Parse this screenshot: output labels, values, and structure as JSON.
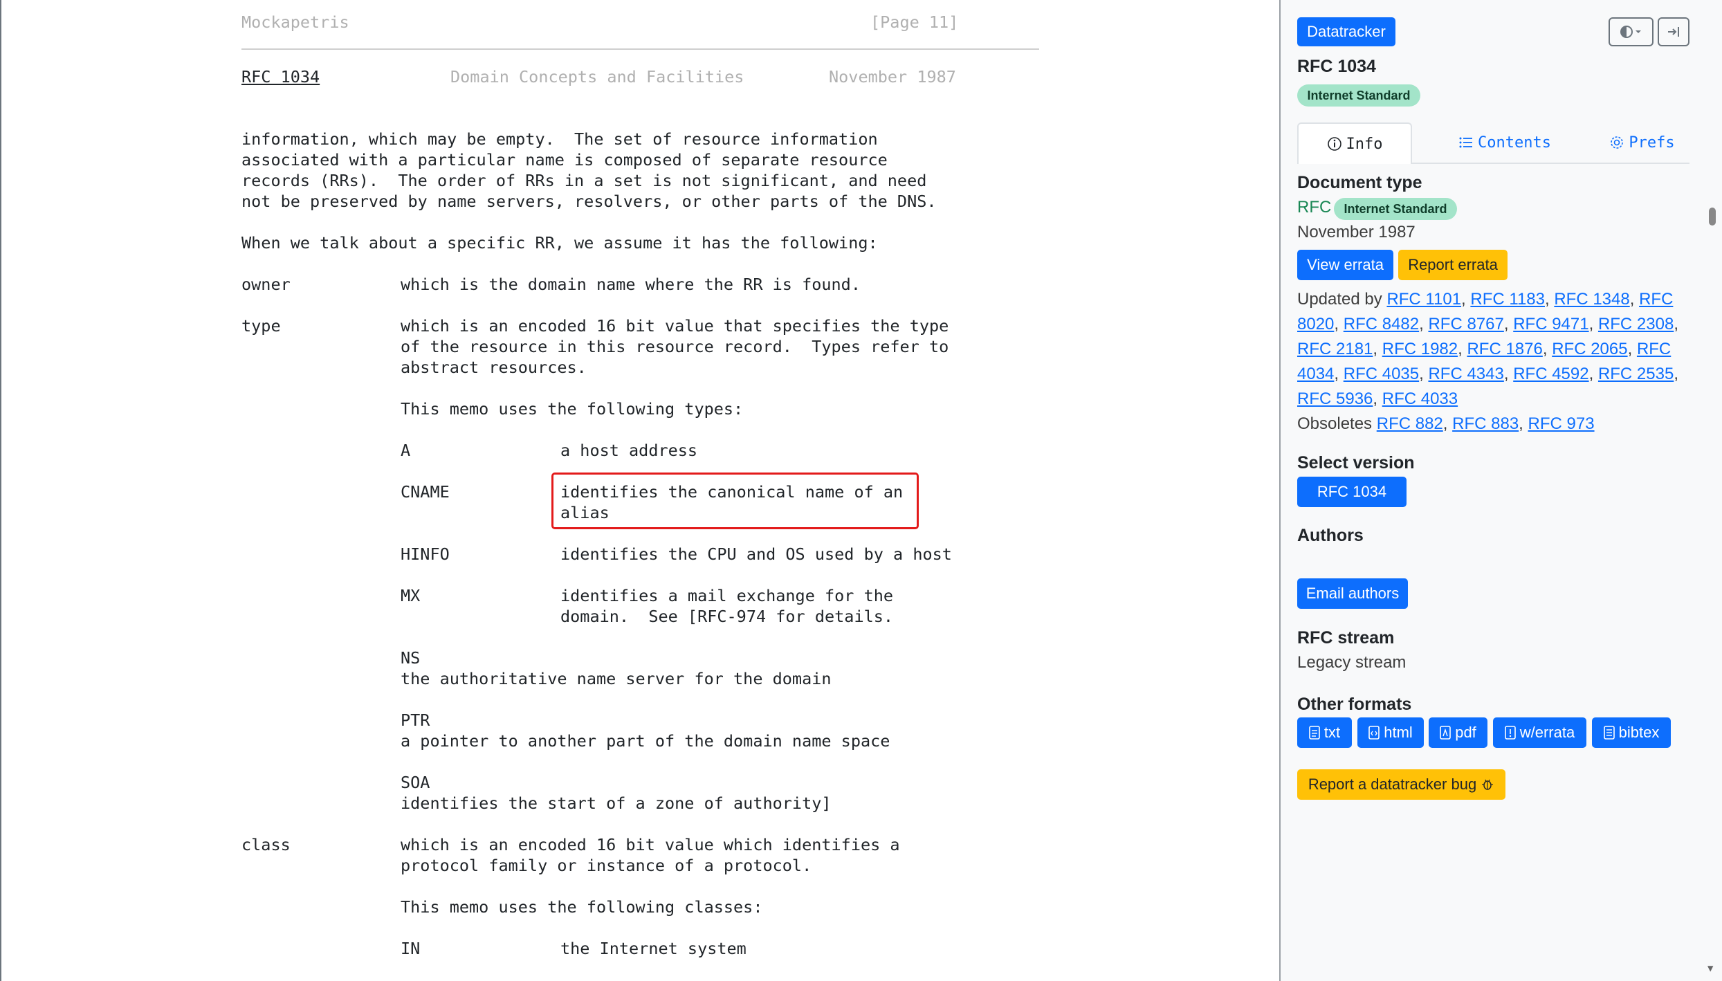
{
  "doc": {
    "header_left": "Mockapetris",
    "header_right": "[Page 11]",
    "running_rfc_link": "RFC 1034",
    "running_title": "Domain Concepts and Facilities",
    "running_date": "November 1987",
    "lines": {
      "p1_1": "information, which may be empty.  The set of resource information",
      "p1_2": "associated with a particular name is composed of separate resource",
      "p1_3": "records (RRs).  The order of RRs in a set is not significant, and need",
      "p1_4": "not be preserved by name servers, resolvers, or other parts of the DNS.",
      "p2": "When we talk about a specific RR, we assume it has the following:",
      "owner_term": "owner",
      "owner_def": "which is the domain name where the RR is found.",
      "type_term": "type",
      "type_def_1": "which is an encoded 16 bit value that specifies the type",
      "type_def_2": "of the resource in this resource record.  Types refer to",
      "type_def_3": "abstract resources.",
      "types_intro": "This memo uses the following types:",
      "a_term": "A",
      "a_def": "a host address",
      "cname_term": "CNAME",
      "cname_def_1": "identifies the canonical name of an",
      "cname_def_2": "alias",
      "hinfo_term": "HINFO",
      "hinfo_def": "identifies the CPU and OS used by a host",
      "mx_term": "MX",
      "mx_def_1": "identifies a mail exchange for the",
      "mx_def_2": "domain.  See [RFC-974 for details.",
      "ns_term": "NS",
      "ns_def": "the authoritative name server for the domain",
      "ptr_term": "PTR",
      "ptr_def": "a pointer to another part of the domain name space",
      "soa_term": "SOA",
      "soa_def": "identifies the start of a zone of authority]",
      "class_term": "class",
      "class_def_1": "which is an encoded 16 bit value which identifies a",
      "class_def_2": "protocol family or instance of a protocol.",
      "classes_intro": "This memo uses the following classes:",
      "in_term": "IN",
      "in_def": "the Internet system"
    }
  },
  "sidebar": {
    "datatracker_button": "Datatracker",
    "title": "RFC 1034",
    "status_badge": "Internet Standard",
    "tabs": {
      "info": "Info",
      "contents": "Contents",
      "prefs": "Prefs"
    },
    "document_type_heading": "Document type",
    "doc_type": "RFC",
    "doc_type_badge": "Internet Standard",
    "date": "November 1987",
    "view_errata": "View errata",
    "report_errata": "Report errata",
    "updated_by_label": "Updated by",
    "updated_by": [
      "RFC 1101",
      "RFC 1183",
      "RFC 1348",
      "RFC 8020",
      "RFC 8482",
      "RFC 8767",
      "RFC 9471",
      "RFC 2308",
      "RFC 2181",
      "RFC 1982",
      "RFC 1876",
      "RFC 2065",
      "RFC 4034",
      "RFC 4035",
      "RFC 4343",
      "RFC 4592",
      "RFC 2535",
      "RFC 5936",
      "RFC 4033"
    ],
    "obsoletes_label": "Obsoletes",
    "obsoletes": [
      "RFC 882",
      "RFC 883",
      "RFC 973"
    ],
    "select_version_heading": "Select version",
    "version_button": "RFC 1034",
    "authors_heading": "Authors",
    "email_authors": "Email authors",
    "rfc_stream_heading": "RFC stream",
    "rfc_stream": "Legacy stream",
    "other_formats_heading": "Other formats",
    "formats": [
      "txt",
      "html",
      "pdf",
      "w/errata",
      "bibtex"
    ],
    "report_bug": "Report a datatracker bug"
  },
  "colors": {
    "primary": "#0d6efd",
    "warning": "#ffc107",
    "badge": "#a3e4c9",
    "highlight": "#e31b1b"
  }
}
